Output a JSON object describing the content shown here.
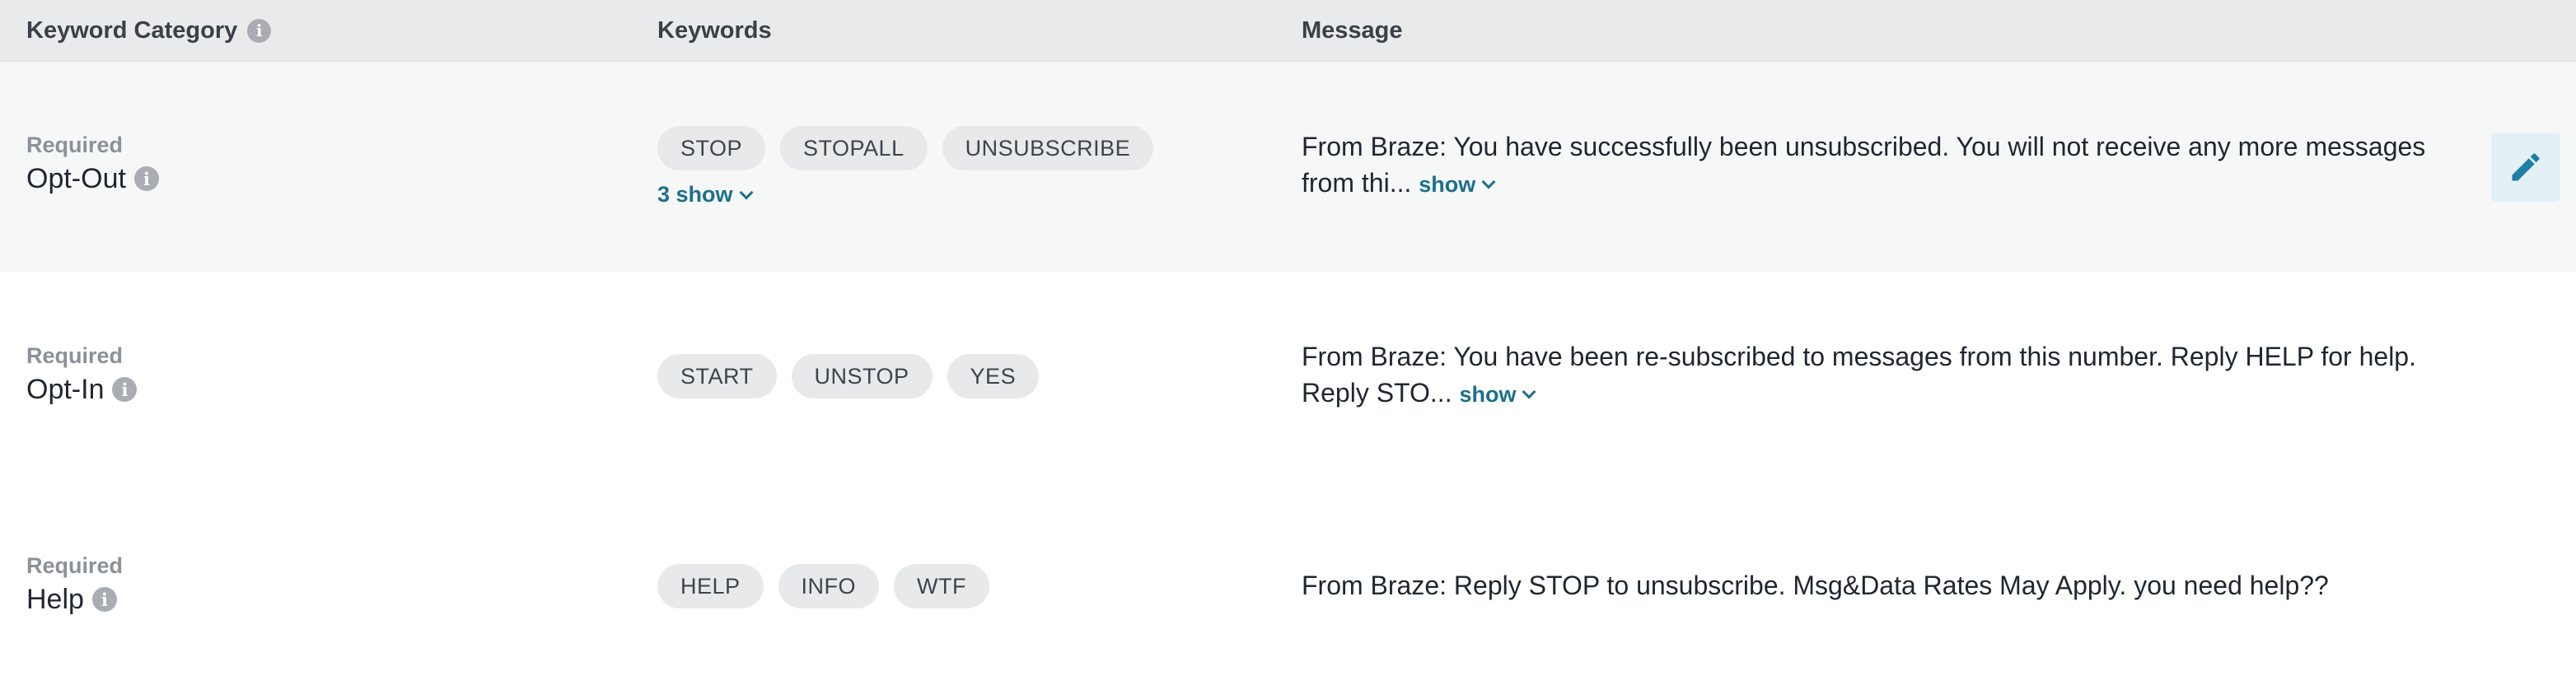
{
  "header": {
    "col_category": "Keyword Category",
    "col_keywords": "Keywords",
    "col_message": "Message",
    "info_glyph": "i"
  },
  "rows": [
    {
      "required_label": "Required",
      "category": "Opt-Out",
      "keywords": [
        "STOP",
        "STOPALL",
        "UNSUBSCRIBE"
      ],
      "keywords_more": "3 show",
      "message": "From Braze: You have successfully been unsubscribed. You will not receive any more messages from thi...",
      "message_show": "show",
      "editable": true
    },
    {
      "required_label": "Required",
      "category": "Opt-In",
      "keywords": [
        "START",
        "UNSTOP",
        "YES"
      ],
      "message": "From Braze: You have been re-subscribed to messages from this number. Reply HELP for help. Reply STO...",
      "message_show": "show"
    },
    {
      "required_label": "Required",
      "category": "Help",
      "keywords": [
        "HELP",
        "INFO",
        "WTF"
      ],
      "message": "From Braze: Reply STOP to unsubscribe. Msg&Data Rates May Apply. you need help??"
    }
  ],
  "icons": {
    "info": "info-icon",
    "edit": "pencil-icon",
    "expand": "chevron-down-icon"
  },
  "colors": {
    "header_bg": "#e9eaec",
    "row_highlight": "#f6f8f7",
    "link": "#1d6f8d",
    "pill_bg": "#e8e9ea",
    "edit_bg": "#e3f1f6"
  }
}
